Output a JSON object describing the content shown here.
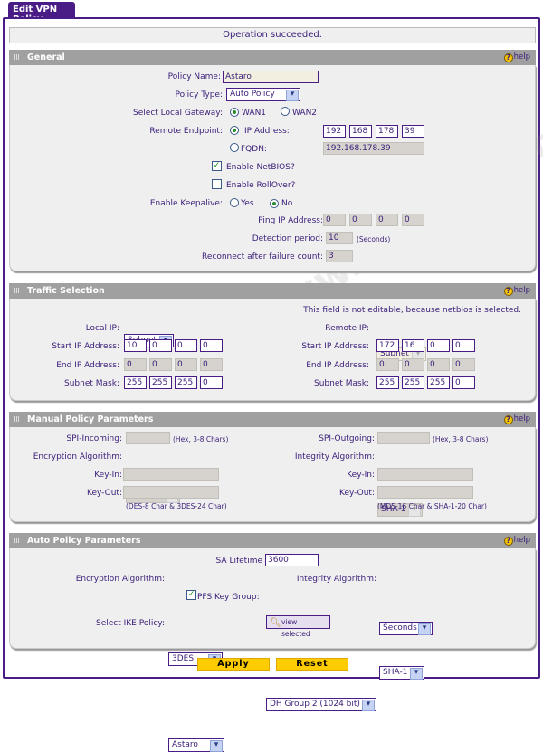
{
  "tab_title": "Edit VPN Policy",
  "status_message": "Operation succeeded.",
  "watermark": "©www.nwlab.net",
  "help_label": "help",
  "general": {
    "title": "General",
    "policy_name_label": "Policy Name:",
    "policy_name": "Astaro",
    "policy_type_label": "Policy Type:",
    "policy_type": "Auto Policy",
    "gateway_label": "Select Local Gateway:",
    "wan1": "WAN1",
    "wan2": "WAN2",
    "gateway_selected": "WAN1",
    "remote_endpoint_label": "Remote Endpoint:",
    "ip_address_label": "IP Address:",
    "remote_ip": [
      "192",
      "168",
      "178",
      "39"
    ],
    "fqdn_label": "FQDN:",
    "fqdn": "192.168.178.39",
    "endpoint_selected": "IP Address",
    "netbios_label": "Enable NetBIOS?",
    "netbios": true,
    "rollover_label": "Enable RollOver?",
    "rollover": false,
    "keepalive_label": "Enable Keepalive:",
    "yes": "Yes",
    "no": "No",
    "keepalive": "No",
    "ping_label": "Ping IP Address:",
    "ping_ip": [
      "0",
      "0",
      "0",
      "0"
    ],
    "detection_label": "Detection period:",
    "detection": "10",
    "seconds_unit": "(Seconds)",
    "reconnect_label": "Reconnect after failure count:",
    "reconnect": "3"
  },
  "traffic": {
    "title": "Traffic Selection",
    "note": "This field is not editable, because netbios is selected.",
    "local_ip_label": "Local IP:",
    "local_ip_type": "Subnet",
    "remote_ip_label": "Remote IP:",
    "remote_ip_type": "Subnet",
    "start_label": "Start IP Address:",
    "end_label": "End IP Address:",
    "mask_label": "Subnet Mask:",
    "local_start": [
      "10",
      "0",
      "0",
      "0"
    ],
    "local_end": [
      "0",
      "0",
      "0",
      "0"
    ],
    "local_mask": [
      "255",
      "255",
      "255",
      "0"
    ],
    "remote_start": [
      "172",
      "16",
      "0",
      "0"
    ],
    "remote_end": [
      "0",
      "0",
      "0",
      "0"
    ],
    "remote_mask": [
      "255",
      "255",
      "255",
      "0"
    ]
  },
  "manual": {
    "title": "Manual Policy Parameters",
    "spi_in_label": "SPI-Incoming:",
    "spi_out_label": "SPI-Outgoing:",
    "spi_hint": "(Hex, 3-8 Chars)",
    "enc_label": "Encryption Algorithm:",
    "enc": "3DES",
    "int_label": "Integrity Algorithm:",
    "int": "SHA-1",
    "key_in_label": "Key-In:",
    "key_out_label": "Key-Out:",
    "enc_hint": "(DES-8 Char & 3DES-24 Char)",
    "int_hint": "(MD5-16 Char & SHA-1-20 Char)"
  },
  "auto": {
    "title": "Auto Policy Parameters",
    "sa_label": "SA Lifetime",
    "sa": "3600",
    "sa_unit": "Seconds",
    "enc_label": "Encryption Algorithm:",
    "enc": "3DES",
    "int_label": "Integrity Algorithm:",
    "int": "SHA-1",
    "pfs_label": "PFS Key Group:",
    "pfs": true,
    "pfs_group": "DH Group 2 (1024 bit)",
    "ike_label": "Select IKE Policy:",
    "ike": "Astaro",
    "view_selected": "view selected"
  },
  "buttons": {
    "apply": "Apply",
    "reset": "Reset"
  }
}
